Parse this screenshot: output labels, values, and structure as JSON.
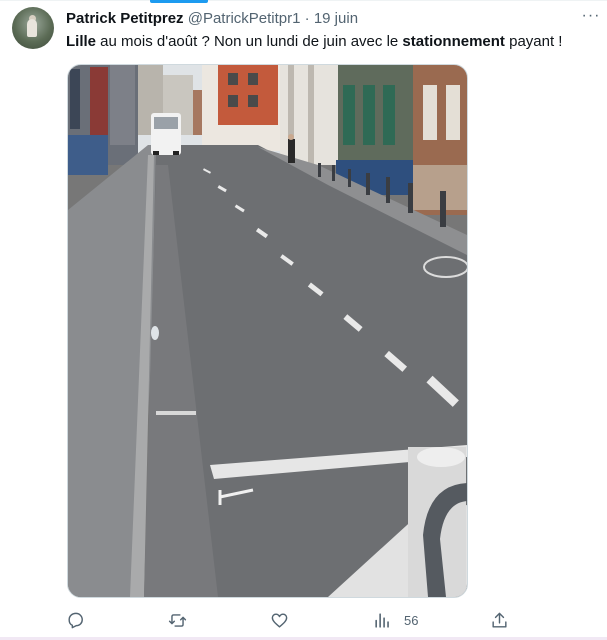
{
  "tweet": {
    "author_name": "Patrick Petitprez",
    "handle": "@PatrickPetitpr1",
    "separator": "·",
    "date": "19 juin",
    "more_label": "···",
    "text_parts": {
      "p1": "Lille",
      "p2": " au mois d'août ? Non un lundi de juin avec le ",
      "p3": "stationnement",
      "p4": " payant !"
    },
    "image_alt": "Rue vide avec piste cyclable et emplacements de stationnement"
  },
  "actions": {
    "reply_icon": "reply-icon",
    "retweet_icon": "retweet-icon",
    "like_icon": "heart-icon",
    "views_icon": "bar-chart-icon",
    "views_count": "56",
    "share_icon": "share-icon"
  },
  "colors": {
    "accent": "#1d9bf0",
    "secondary_text": "#536471",
    "primary_text": "#0f1419"
  }
}
